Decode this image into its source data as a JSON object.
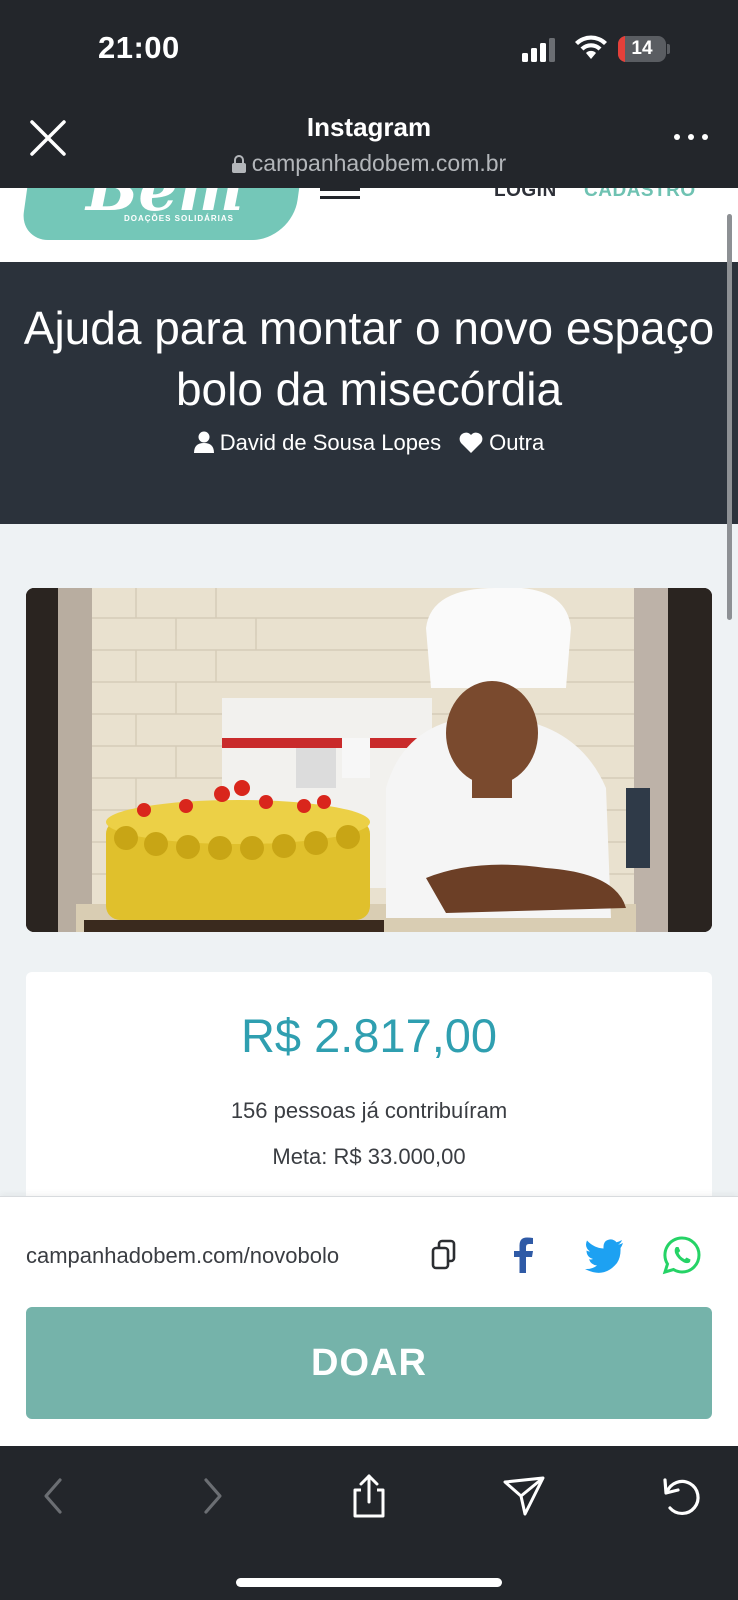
{
  "status_bar": {
    "time": "21:00",
    "battery": "14",
    "battery_level": 0.14
  },
  "browser": {
    "title": "Instagram",
    "url": "campanhadobem.com.br"
  },
  "site": {
    "logo_word": "Bem",
    "logo_tagline": "DOAÇÕES SOLIDÁRIAS",
    "login_label": "LOGIN",
    "signup_label": "CADASTRO"
  },
  "campaign": {
    "title": "Ajuda para montar o novo espaço bolo da misecórdia",
    "author": "David de Sousa Lopes",
    "category": "Outra",
    "amount_raised": "R$ 2.817,00",
    "contributors": "156 pessoas já contribuíram",
    "goal": "Meta: R$ 33.000,00"
  },
  "share": {
    "link": "campanhadobem.com/novobolo",
    "donate_label": "DOAR"
  },
  "colors": {
    "dark_header": "#23262b",
    "hero_bg": "#2b323b",
    "accent_teal": "#74c7b8",
    "amount_blue": "#2f9fb0",
    "donate_button": "#75b3aa",
    "facebook": "#2f5aa6",
    "twitter": "#1da1f2",
    "whatsapp": "#25d366"
  }
}
